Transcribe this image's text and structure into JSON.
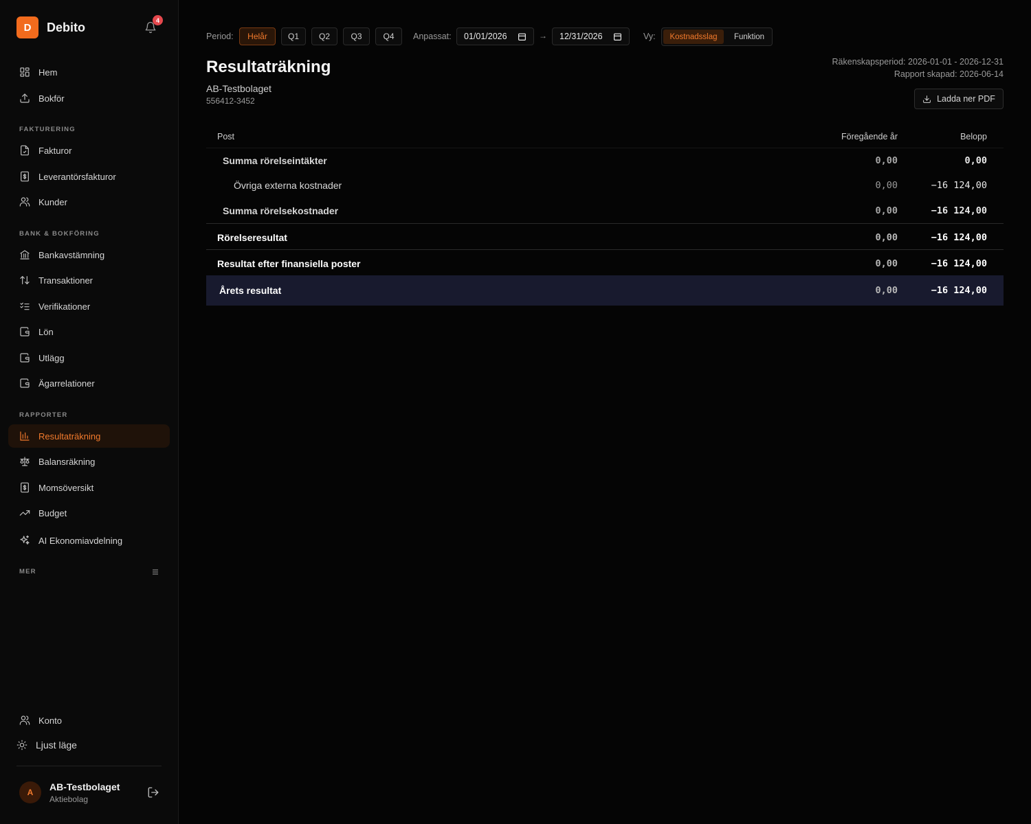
{
  "brand": {
    "logo_letter": "D",
    "name": "Debito",
    "notification_count": "4"
  },
  "nav": {
    "top": [
      {
        "label": "Hem",
        "icon": "grid-icon"
      },
      {
        "label": "Bokför",
        "icon": "upload-icon"
      }
    ],
    "sections": [
      {
        "label": "FAKTURERING",
        "items": [
          {
            "label": "Fakturor",
            "icon": "document-icon"
          },
          {
            "label": "Leverantörsfakturor",
            "icon": "dollar-document-icon"
          },
          {
            "label": "Kunder",
            "icon": "users-icon"
          }
        ]
      },
      {
        "label": "BANK & BOKFÖRING",
        "items": [
          {
            "label": "Bankavstämning",
            "icon": "bank-icon"
          },
          {
            "label": "Transaktioner",
            "icon": "arrows-updown-icon"
          },
          {
            "label": "Verifikationer",
            "icon": "checklist-icon"
          },
          {
            "label": "Lön",
            "icon": "wallet-icon"
          },
          {
            "label": "Utlägg",
            "icon": "wallet-icon"
          },
          {
            "label": "Ägarrelationer",
            "icon": "wallet-icon"
          }
        ]
      },
      {
        "label": "RAPPORTER",
        "items": [
          {
            "label": "Resultaträkning",
            "icon": "bar-chart-icon",
            "active": true
          },
          {
            "label": "Balansräkning",
            "icon": "scale-icon"
          },
          {
            "label": "Momsöversikt",
            "icon": "dollar-document-icon"
          },
          {
            "label": "Budget",
            "icon": "trend-up-icon"
          },
          {
            "label": "AI Ekonomiavdelning",
            "icon": "sparkles-icon"
          }
        ]
      },
      {
        "label": "MER",
        "items": []
      }
    ],
    "bottom": [
      {
        "label": "Konto",
        "icon": "users-icon"
      },
      {
        "label": "Ljust läge",
        "icon": "sun-icon"
      }
    ]
  },
  "account": {
    "avatar_letter": "A",
    "name": "AB-Testbolaget",
    "type": "Aktiebolag"
  },
  "filters": {
    "period_label": "Period:",
    "period_options": [
      "Helår",
      "Q1",
      "Q2",
      "Q3",
      "Q4"
    ],
    "period_selected": "Helår",
    "custom_label": "Anpassat:",
    "date_from": "01/01/2026",
    "date_arrow": "→",
    "date_to": "12/31/2026",
    "view_label": "Vy:",
    "view_options": [
      "Kostnadsslag",
      "Funktion"
    ],
    "view_selected": "Kostnadsslag"
  },
  "report": {
    "title": "Resultaträkning",
    "company": "AB-Testbolaget",
    "org_number": "556412-3452",
    "fiscal_period": "Räkenskapsperiod: 2026-01-01 - 2026-12-31",
    "created": "Rapport skapad: 2026-06-14",
    "download_label": "Ladda ner PDF"
  },
  "table": {
    "headers": {
      "post": "Post",
      "previous": "Föregående år",
      "amount": "Belopp"
    },
    "rows": [
      {
        "label": "Summa rörelseintäkter",
        "previous": "0,00",
        "amount": "0,00",
        "style": "sub"
      },
      {
        "label": "Övriga externa kostnader",
        "previous": "0,00",
        "amount": "−16 124,00",
        "style": "item"
      },
      {
        "label": "Summa rörelsekostnader",
        "previous": "0,00",
        "amount": "−16 124,00",
        "style": "sub"
      },
      {
        "label": "Rörelseresultat",
        "previous": "0,00",
        "amount": "−16 124,00",
        "style": "bold"
      },
      {
        "label": "Resultat efter finansiella poster",
        "previous": "0,00",
        "amount": "−16 124,00",
        "style": "bold"
      },
      {
        "label": "Årets resultat",
        "previous": "0,00",
        "amount": "−16 124,00",
        "style": "total"
      }
    ]
  },
  "colors": {
    "accent": "#f26b1d",
    "badge": "#e5484d",
    "total_row_bg": "#181a2e"
  }
}
